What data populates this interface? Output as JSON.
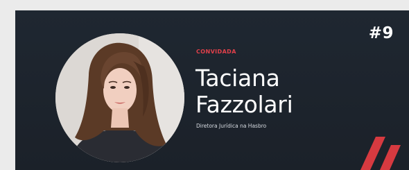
{
  "card": {
    "eyebrow": "CONVIDADA",
    "name_first": "Taciana",
    "name_last": "Fazzolari",
    "role": "Diretora Jurídica na Hasbro",
    "episode": "#9"
  },
  "colors": {
    "card_bg": "#1f2731",
    "accent": "#e2404a",
    "text": "#ffffff"
  },
  "icons": {
    "avatar": "guest-photo",
    "logo": "brand-slash-logo"
  }
}
